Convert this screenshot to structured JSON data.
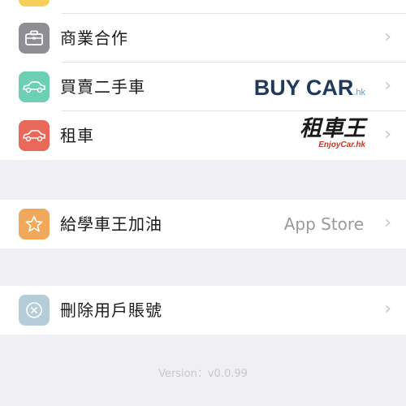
{
  "colors": {
    "business_icon": "#8e8e93",
    "used_car_icon": "#6dd0b4",
    "rent_icon": "#e8685a",
    "rate_icon": "#f0a95a",
    "delete_icon": "#b5cdd8",
    "background": "#efeff4"
  },
  "menu": {
    "group1": [
      {
        "label": "商業合作",
        "icon": "briefcase-icon"
      },
      {
        "label": "買賣二手車",
        "icon": "car-icon",
        "brand": "BUY CAR",
        "brand_suffix": ".hk"
      },
      {
        "label": "租車",
        "icon": "car-icon",
        "brand": "租車王",
        "brand_sub": "EnjoyCar.hk"
      }
    ],
    "group2": [
      {
        "label": "給學車王加油",
        "icon": "star-icon",
        "detail": "App Store"
      }
    ],
    "group3": [
      {
        "label": "刪除用戶賬號",
        "icon": "close-circle-icon"
      }
    ]
  },
  "version": "Version：v0.0.99",
  "chevron": "›"
}
